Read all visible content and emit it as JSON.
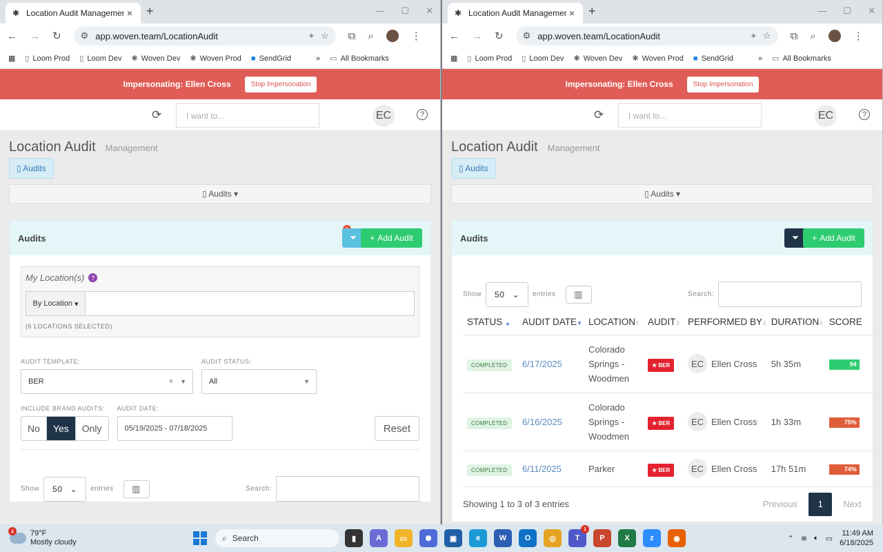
{
  "browser": {
    "tab_title": "Location Audit Management",
    "url": "app.woven.team/LocationAudit",
    "bookmarks": [
      "Loom Prod",
      "Loom Dev",
      "Woven Dev",
      "Woven Prod",
      "SendGrid"
    ],
    "all_bookmarks": "All Bookmarks",
    "more": "»"
  },
  "impersonation": {
    "text": "Impersonating: Ellen Cross",
    "stop_label": "Stop Impersonation"
  },
  "topnav": {
    "search_placeholder": "I want to...",
    "user_initials": "EC",
    "help": "?"
  },
  "page": {
    "title": "Location Audit",
    "subtitle": "Management",
    "pill_label": "Audits",
    "dropdown_label": "Audits"
  },
  "panel": {
    "title": "Audits",
    "filter_badge": "1",
    "add_label": "Add Audit"
  },
  "filters": {
    "my_locations_label": "My Location(s)",
    "by_location": "By Location",
    "locations_selected": "(6 LOCATIONS SELECTED)",
    "audit_template_label": "AUDIT TEMPLATE:",
    "audit_template_value": "BER",
    "audit_status_label": "AUDIT STATUS:",
    "audit_status_value": "All",
    "brand_audits_label": "INCLUDE BRAND AUDITS:",
    "brand_options": [
      "No",
      "Yes",
      "Only"
    ],
    "brand_selected": "Yes",
    "audit_date_label": "AUDIT DATE:",
    "audit_date_value": "05/19/2025 - 07/18/2025",
    "reset_label": "Reset"
  },
  "table_controls": {
    "show": "Show",
    "entries_value": "50",
    "entries": "entries",
    "search": "Search:"
  },
  "table": {
    "columns": [
      "STATUS",
      "AUDIT DATE",
      "LOCATION",
      "AUDIT",
      "PERFORMED BY",
      "DURATION",
      "SCORE"
    ],
    "rows": [
      {
        "status": "COMPLETED",
        "date": "6/17/2025",
        "location": "Colorado Springs - Woodmen",
        "audit": "BER",
        "initials": "EC",
        "performer": "Ellen Cross",
        "duration": "5h 35m",
        "score": "94",
        "score_color": "#2ecc71"
      },
      {
        "status": "COMPLETED",
        "date": "6/16/2025",
        "location": "Colorado Springs - Woodmen",
        "audit": "BER",
        "initials": "EC",
        "performer": "Ellen Cross",
        "duration": "1h 33m",
        "score": "75%",
        "score_color": "#e05d3a"
      },
      {
        "status": "COMPLETED",
        "date": "6/11/2025",
        "location": "Parker",
        "audit": "BER",
        "initials": "EC",
        "performer": "Ellen Cross",
        "duration": "17h 51m",
        "score": "74%",
        "score_color": "#e05d3a"
      }
    ],
    "showing": "Showing 1 to 3 of 3 entries",
    "previous": "Previous",
    "page": "1",
    "next": "Next"
  },
  "taskbar": {
    "temp": "79°F",
    "weather": "Mostly cloudy",
    "weather_badge": "4",
    "search": "Search",
    "time": "11:49 AM",
    "date": "6/18/2025",
    "teams_badge": "1"
  }
}
